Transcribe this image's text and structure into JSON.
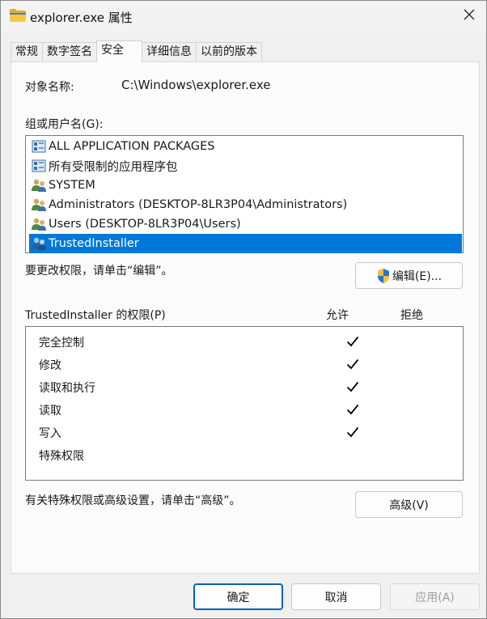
{
  "window": {
    "title": "explorer.exe 属性"
  },
  "tabs": [
    {
      "label": "常规"
    },
    {
      "label": "数字签名"
    },
    {
      "label": "安全"
    },
    {
      "label": "详细信息"
    },
    {
      "label": "以前的版本"
    }
  ],
  "object": {
    "label": "对象名称:",
    "value": "C:\\Windows\\explorer.exe"
  },
  "groups": {
    "label": "组或用户名(G):",
    "items": [
      {
        "label": "ALL APPLICATION PACKAGES",
        "icon": "package-icon"
      },
      {
        "label": "所有受限制的应用程序包",
        "icon": "package-icon"
      },
      {
        "label": "SYSTEM",
        "icon": "users-icon"
      },
      {
        "label": "Administrators (DESKTOP-8LR3P04\\Administrators)",
        "icon": "users-icon"
      },
      {
        "label": "Users (DESKTOP-8LR3P04\\Users)",
        "icon": "users-icon"
      },
      {
        "label": "TrustedInstaller",
        "icon": "users-icon",
        "selected": true
      }
    ]
  },
  "edit": {
    "hint": "要更改权限，请单击“编辑”。",
    "button": "编辑(E)..."
  },
  "permissions": {
    "title": "TrustedInstaller 的权限(P)",
    "allow_header": "允许",
    "deny_header": "拒绝",
    "rows": [
      {
        "name": "完全控制",
        "allow": true,
        "deny": false
      },
      {
        "name": "修改",
        "allow": true,
        "deny": false
      },
      {
        "name": "读取和执行",
        "allow": true,
        "deny": false
      },
      {
        "name": "读取",
        "allow": true,
        "deny": false
      },
      {
        "name": "写入",
        "allow": true,
        "deny": false
      },
      {
        "name": "特殊权限",
        "allow": false,
        "deny": false
      }
    ]
  },
  "advanced": {
    "hint": "有关特殊权限或高级设置，请单击“高级”。",
    "button": "高级(V)"
  },
  "footer": {
    "ok": "确定",
    "cancel": "取消",
    "apply": "应用(A)"
  },
  "colors": {
    "selection": "#0078d7",
    "accent_border": "#0063b1",
    "check": "#000000"
  }
}
